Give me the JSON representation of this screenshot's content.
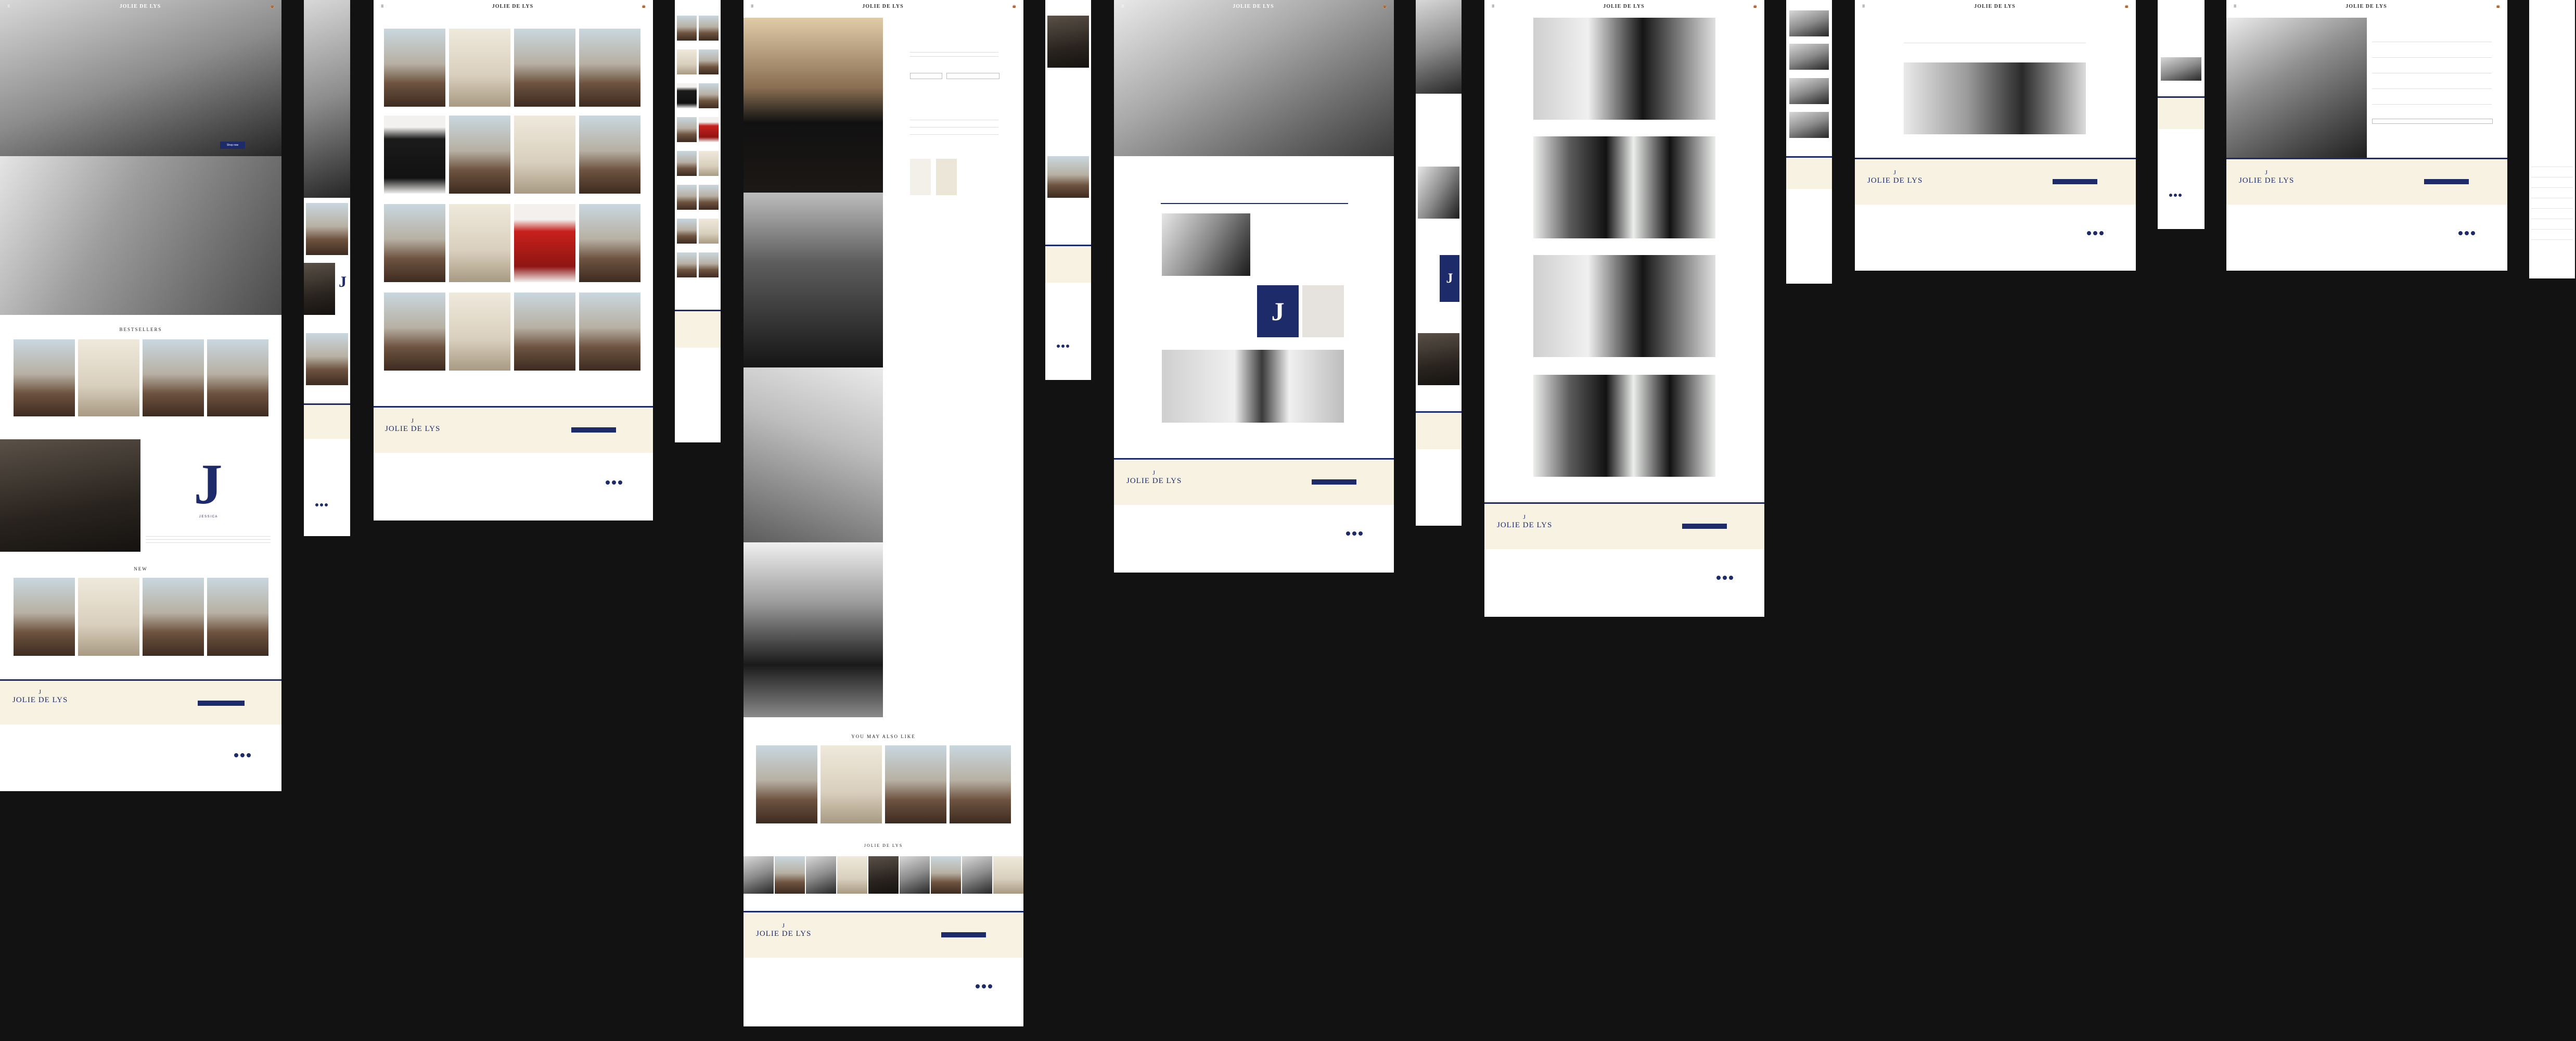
{
  "brand": {
    "logo_text": "JOLIE DE LYS",
    "logo_sub": "APPAREL",
    "monogram": "J",
    "logo_subline": "J E S S I C A",
    "accent_color": "#1e2b6b",
    "cream_color": "#f7f2e2"
  },
  "home": {
    "bestsellers_title": "BESTSELLERS",
    "new_title": "NEW",
    "hero_button": "Shop now"
  },
  "product_page": {
    "you_may_also_like": "YOU MAY ALSO LIKE",
    "instagram_title": "JOLIE DE LYS"
  },
  "icons": {
    "menu": "hamburger-icon",
    "search": "search-icon",
    "bag": "bag-icon",
    "arrow_left": "chevron-left-icon",
    "arrow_right": "chevron-right-icon"
  }
}
